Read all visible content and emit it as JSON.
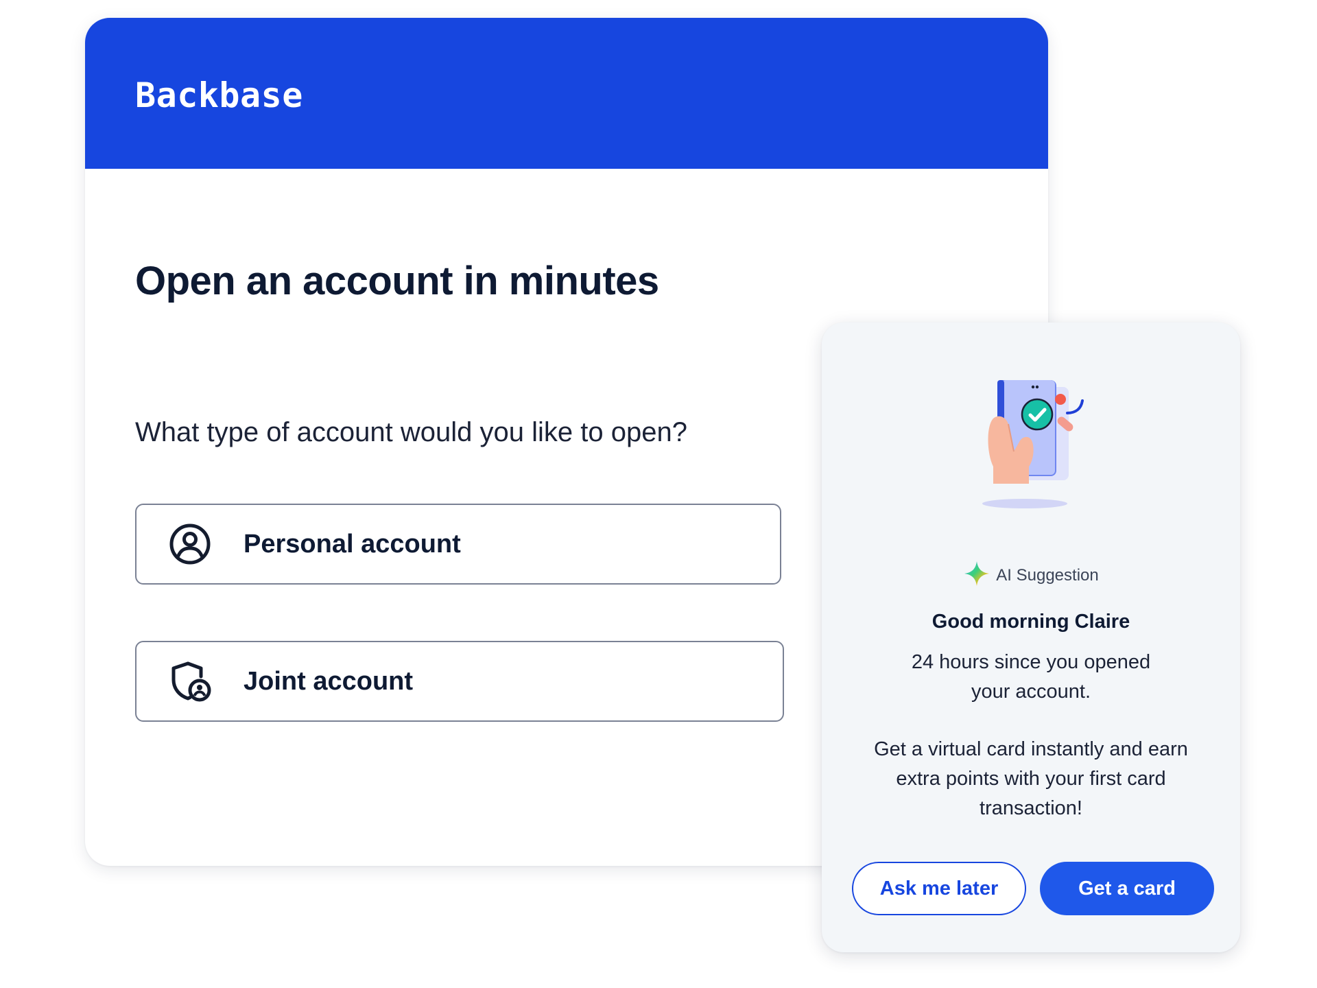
{
  "brand": {
    "logo_text": "Backbase",
    "primary_color": "#1746df"
  },
  "main": {
    "title": "Open an account in minutes",
    "question": "What type of account would you like to open?",
    "options": [
      {
        "label": "Personal account",
        "icon": "person-circle-icon"
      },
      {
        "label": "Joint account",
        "icon": "shield-user-icon"
      }
    ]
  },
  "ai_card": {
    "tag_label": "AI Suggestion",
    "tag_icon": "sparkle-icon",
    "illustration": "hand-phone-check-illustration",
    "greeting": "Good morning Claire",
    "since_text": "24 hours since you opened your account.",
    "promo_text": "Get a virtual card instantly and earn extra points with your first card transaction!",
    "secondary_button": "Ask me later",
    "primary_button": "Get a card",
    "button_color": "#1f58ea",
    "background_color": "#f3f6f9"
  }
}
